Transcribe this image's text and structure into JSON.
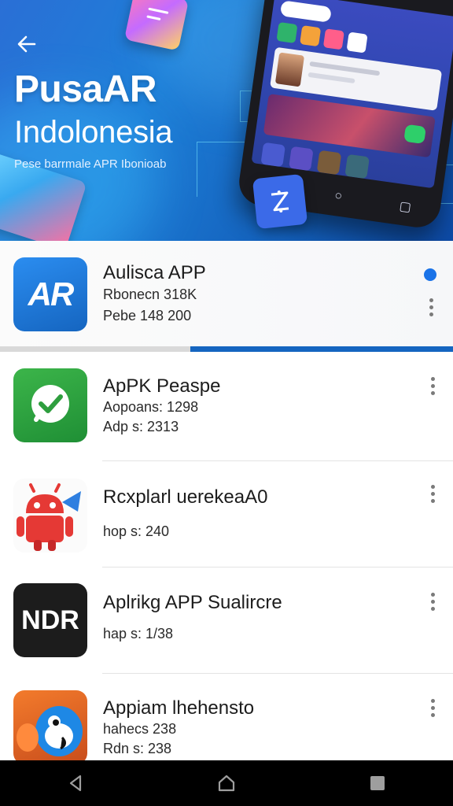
{
  "hero": {
    "title_line1": "PusaAR",
    "title_line2": "Indolonesia",
    "subtitle": "Pese barrmale APR Ibonioab"
  },
  "phone_mockup": {
    "nav_icons": [
      "back-triangle-icon",
      "home-circle-icon",
      "recents-square-icon"
    ]
  },
  "featured_app": {
    "icon_text": "AR",
    "name": "Aulisca APP",
    "meta1": "Rbonecn 318K",
    "meta2": "Pebe 148 200",
    "progress": 0.58
  },
  "apps": [
    {
      "name": "ApPK Peaspe",
      "meta1": "Aopoans: 1298",
      "meta2": "Adp s: 2313",
      "icon": "check-icon",
      "color": "#2e9e3e"
    },
    {
      "name": "Rcxplarl uerekeaA0",
      "meta1": "",
      "meta2": "hop s: 240",
      "icon": "android-robot-icon",
      "color": "#e53935"
    },
    {
      "name": "Aplrikg APP Sualircre",
      "meta1": "",
      "meta2": "hap s: 1/38",
      "icon_text": "NDR",
      "color": "#1c1c1c"
    },
    {
      "name": "Appiam lhehensto",
      "meta1": "hahecs 238",
      "meta2": "Rdn s: 238",
      "icon": "bird-mascot-icon",
      "color": "#1e88e5"
    }
  ],
  "colors": {
    "hero_blue": "#1e7fd8",
    "accent": "#1a73e8",
    "progress": "#1565c0"
  },
  "system_nav": [
    "back-icon",
    "home-icon",
    "recents-icon"
  ]
}
